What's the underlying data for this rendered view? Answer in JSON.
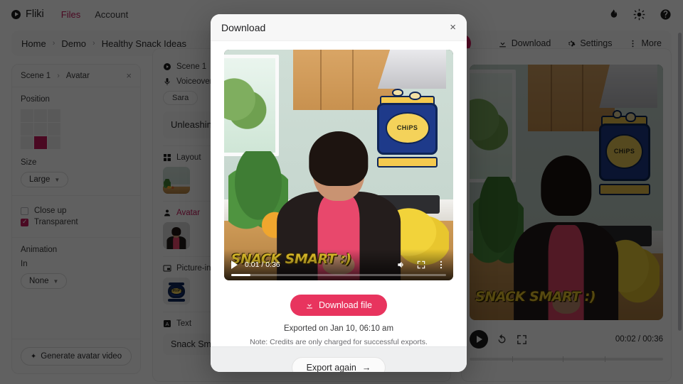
{
  "topbar": {
    "brand": "Fliki",
    "nav": [
      {
        "label": "Files",
        "active": true
      },
      {
        "label": "Account",
        "active": false
      }
    ],
    "icons": [
      "flame-icon",
      "sun-icon",
      "help-icon"
    ]
  },
  "toolbar": {
    "breadcrumb": [
      "Home",
      "Demo",
      "Healthy Snack Ideas"
    ],
    "separator": "›",
    "primary_button": "e",
    "items": [
      {
        "label": "Download",
        "icon": "download-icon"
      },
      {
        "label": "Settings",
        "icon": "gear-icon"
      },
      {
        "label": "More",
        "icon": "kebab-icon"
      }
    ]
  },
  "left_panel": {
    "breadcrumb_scene": "Scene 1",
    "breadcrumb_sep": "›",
    "breadcrumb_item": "Avatar",
    "close": "×",
    "position_label": "Position",
    "position_selected_index": 7,
    "size_label": "Size",
    "size_value": "Large",
    "checkboxes": [
      {
        "label": "Close up",
        "checked": false
      },
      {
        "label": "Transparent",
        "checked": true
      }
    ],
    "animation_label": "Animation",
    "animation_in_label": "In",
    "animation_in_value": "None",
    "generate_button": "Generate avatar video",
    "generate_icon": "sparkle-icon"
  },
  "mid_panel": {
    "scene_label": "Scene 1",
    "scene_icon": "play-circle-icon",
    "voiceover_label": "Voiceover",
    "voiceover_icon": "mic-icon",
    "voice_chip": "Sara",
    "script": "Unleashing Ideas",
    "layout_label": "Layout",
    "layout_icon": "layout-icon",
    "avatar_label": "Avatar",
    "avatar_icon": "person-icon",
    "pip_label": "Picture-in-picture",
    "pip_icon": "pip-icon",
    "text_label": "Text",
    "text_icon": "text-icon",
    "text_value": "Snack Smart"
  },
  "preview": {
    "time": "00:02 / 00:36",
    "play_icon": "play-icon",
    "replay_icon": "replay-icon",
    "fullscreen_icon": "fullscreen-icon",
    "overlay_text": "SNACK SMART :)",
    "chips_label": "CHiPS"
  },
  "modal": {
    "title": "Download",
    "close": "×",
    "video": {
      "time": "0:01 / 0:36",
      "progress_percent": 9,
      "play_icon": "play-icon",
      "volume_icon": "volume-icon",
      "fullscreen_icon": "fullscreen-icon",
      "more_icon": "kebab-icon",
      "overlay_text": "SNACK SMART :)",
      "chips_label": "CHiPS"
    },
    "download_button": "Download file",
    "download_icon": "download-icon",
    "exported_text": "Exported on Jan 10, 06:10 am",
    "note_text": "Note: Credits are only charged for successful exports.",
    "export_again_button": "Export again",
    "export_again_icon": "arrow-right-icon"
  },
  "colors": {
    "accent_pink": "#d81b60",
    "download_pink": "#e8345e",
    "overlay": "rgba(0,0,0,0.62)"
  }
}
